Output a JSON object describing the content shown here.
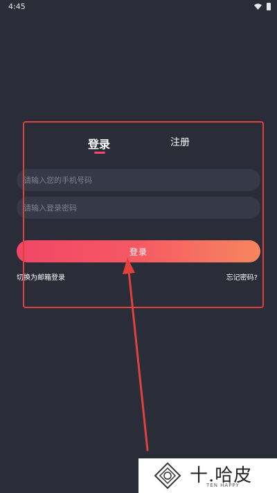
{
  "status_bar": {
    "time": "4:45"
  },
  "tabs": [
    {
      "label": "登录",
      "active": true
    },
    {
      "label": "注册",
      "active": false
    }
  ],
  "form": {
    "phone_placeholder": "请输入您的手机号码",
    "phone_value": "",
    "password_placeholder": "请输入登录密码",
    "password_value": "",
    "login_button_label": "登录",
    "switch_link_label": "切换为邮箱登录",
    "forgot_link_label": "忘记密码?"
  },
  "watermark": {
    "title": "十.哈皮",
    "subtitle": "TEN HAPPY"
  },
  "colors": {
    "background": "#2a2d38",
    "input_background": "#353948",
    "accent": "#f04a6a",
    "button_gradient_start": "#f24567",
    "button_gradient_end": "#f7865f",
    "annotation": "#e0413c"
  }
}
